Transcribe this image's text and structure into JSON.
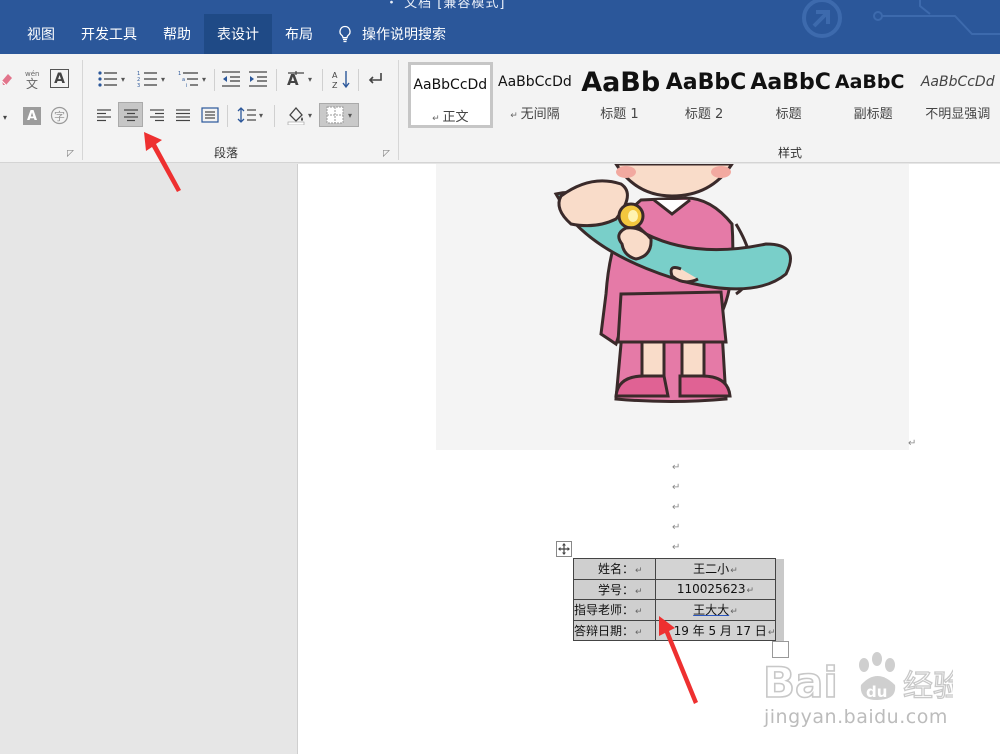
{
  "window": {
    "title_fragment": "・ 文档 [兼容模式]"
  },
  "tabs": [
    {
      "label": "视图"
    },
    {
      "label": "开发工具"
    },
    {
      "label": "帮助"
    },
    {
      "label": "表设计"
    },
    {
      "label": "布局"
    },
    {
      "label": "操作说明搜索"
    }
  ],
  "ribbon": {
    "paragraph_group_label": "段落",
    "styles_group_label": "样式",
    "styles": [
      {
        "preview": "AaBbCcDd",
        "name": "正文"
      },
      {
        "preview": "AaBbCcDd",
        "name": "无间隔"
      },
      {
        "preview": "AaBb",
        "name": "标题 1"
      },
      {
        "preview": "AaBbC",
        "name": "标题 2"
      },
      {
        "preview": "AaBbC",
        "name": "标题"
      },
      {
        "preview": "AaBbC",
        "name": "副标题"
      },
      {
        "preview": "AaBbCcDd",
        "name": "不明显强调"
      }
    ]
  },
  "table": {
    "rows": [
      {
        "label": "姓名：",
        "value": "王二小"
      },
      {
        "label": "学号：",
        "value": "110025623"
      },
      {
        "label": "指导老师：",
        "value": "王大大"
      },
      {
        "label": "答辩日期：",
        "value": "19 年 5 月 17 日"
      }
    ]
  },
  "paragraph_mark": "↵",
  "watermark": {
    "logo_text": "Bai du 经验",
    "url": "jingyan.baidu.com"
  },
  "colors": {
    "accent": "#2b579a",
    "arrow": "#ee3030"
  }
}
